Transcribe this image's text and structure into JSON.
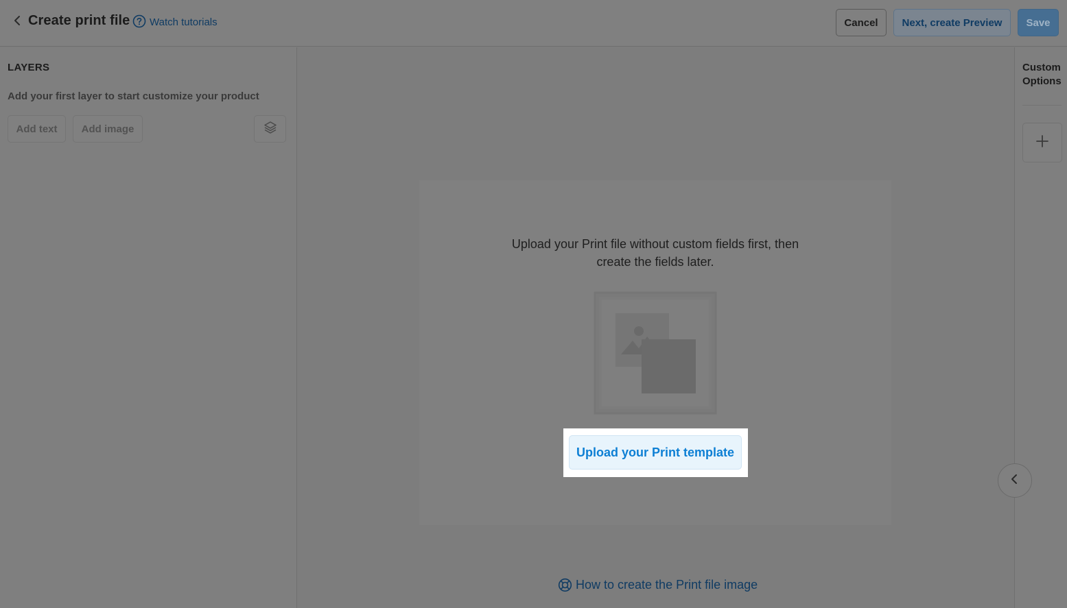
{
  "header": {
    "title": "Create print file",
    "tutorial_link": "Watch tutorials",
    "cancel_label": "Cancel",
    "next_label": "Next, create Preview",
    "save_label": "Save"
  },
  "layers": {
    "title": "LAYERS",
    "hint": "Add your first layer to start customize your product",
    "add_text_label": "Add text",
    "add_image_label": "Add image"
  },
  "custom_options": {
    "label": "Custom Options"
  },
  "canvas": {
    "upload_text_line1": "Upload your Print file without custom fields first, then",
    "upload_text_line2": "create the fields later.",
    "upload_button_label": "Upload your Print template",
    "howto_link": "How to create the Print file image"
  },
  "colors": {
    "link": "#0f3b63",
    "primary_button": "#0d7fd4",
    "overlay": "#7f7f7f"
  },
  "icons": [
    "chevron-left-icon",
    "help-circle-icon",
    "layers-icon",
    "plus-icon",
    "image-placeholder-icon",
    "lifebuoy-icon"
  ]
}
